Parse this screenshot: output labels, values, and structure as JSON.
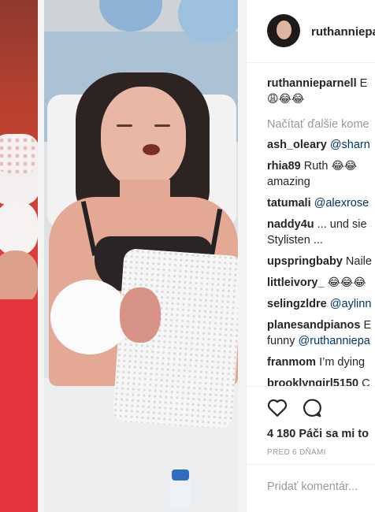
{
  "post": {
    "username": "ruthanniepa",
    "caption_user": "ruthannieparnell",
    "caption_text": "E",
    "caption_emojis": "😩😂😂",
    "load_more": "Načítať ďalšie kome",
    "likes": "4 180 Páči sa mi to",
    "time": "PRED 6 DŇAMI",
    "add_comment_placeholder": "Pridať komentár..."
  },
  "comments": [
    {
      "user": "ash_oleary",
      "text": "",
      "mention": "@sharn",
      "line2": ""
    },
    {
      "user": "rhia89",
      "text": "Ruth",
      "emojis": "😂😂",
      "line2": "amazing"
    },
    {
      "user": "tatumali",
      "text": "",
      "mention": "@alexrose",
      "line2": ""
    },
    {
      "user": "naddy4u",
      "text": "... und sie",
      "line2": "Stylisten ..."
    },
    {
      "user": "upspringbaby",
      "text": "Naile",
      "line2": ""
    },
    {
      "user": "littleivory_",
      "text": "",
      "emojis": "😂😂😂",
      "line2": ""
    },
    {
      "user": "selingzldre",
      "text": "",
      "mention": "@aylinn",
      "line2": ""
    },
    {
      "user": "planesandpianos",
      "text": "E",
      "line2_text": "funny",
      "line2_mention": "@ruthanniepa"
    },
    {
      "user": "franmom",
      "text": "I’m dying",
      "line2": ""
    },
    {
      "user": "brooklyngirl5150",
      "text": "C",
      "line2": ""
    }
  ],
  "icons": {
    "like": "heart-icon",
    "comment": "comment-bubble-icon"
  },
  "colors": {
    "link": "#003569",
    "muted": "#999999",
    "border": "#efefef"
  }
}
